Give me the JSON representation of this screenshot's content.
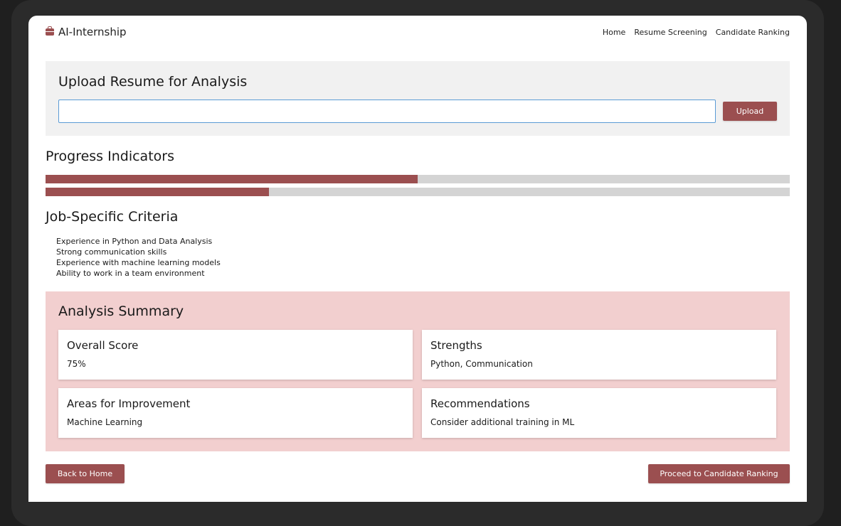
{
  "brand": {
    "name": "AI-Internship",
    "icon": "briefcase-icon"
  },
  "nav": {
    "items": [
      "Home",
      "Resume Screening",
      "Candidate Ranking"
    ]
  },
  "upload": {
    "title": "Upload Resume for Analysis",
    "input_value": "",
    "button_label": "Upload"
  },
  "progress": {
    "title": "Progress Indicators",
    "bars": [
      {
        "value": 0.5
      },
      {
        "value": 0.3
      }
    ]
  },
  "criteria": {
    "title": "Job-Specific Criteria",
    "items": [
      "Experience in Python and Data Analysis",
      "Strong communication skills",
      "Experience with machine learning models",
      "Ability to work in a team environment"
    ]
  },
  "summary": {
    "title": "Analysis Summary",
    "cards": [
      {
        "title": "Overall Score",
        "value": "75%"
      },
      {
        "title": "Strengths",
        "value": "Python, Communication"
      },
      {
        "title": "Areas for Improvement",
        "value": "Machine Learning"
      },
      {
        "title": "Recommendations",
        "value": "Consider additional training in ML"
      }
    ]
  },
  "footer": {
    "back_label": "Back to Home",
    "proceed_label": "Proceed to Candidate Ranking"
  },
  "colors": {
    "accent": "#9b4f50",
    "summary_bg": "#f2cfcf",
    "upload_bg": "#f1f1f1",
    "track": "#d4d4d4",
    "input_border": "#5b9bd5"
  }
}
